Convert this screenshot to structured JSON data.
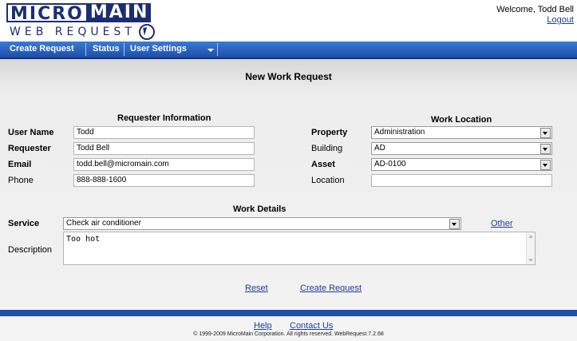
{
  "header": {
    "logo_top_a": "MICRO",
    "logo_top_b": "MAIN",
    "logo_sub": "WEB REQUEST",
    "welcome": "Welcome, Todd Bell",
    "logout": "Logout"
  },
  "nav": {
    "items": [
      {
        "label": "Create Request"
      },
      {
        "label": "Status"
      },
      {
        "label": "User Settings"
      }
    ]
  },
  "page": {
    "title": "New Work Request"
  },
  "requester": {
    "heading": "Requester Information",
    "username_label": "User Name",
    "username_value": "Todd",
    "requester_label": "Requester",
    "requester_value": "Todd Bell",
    "email_label": "Email",
    "email_value": "todd.bell@micromain.com",
    "phone_label": "Phone",
    "phone_value": "888-888-1600"
  },
  "location": {
    "heading": "Work Location",
    "property_label": "Property",
    "property_value": "Administration",
    "building_label": "Building",
    "building_value": "AD",
    "asset_label": "Asset",
    "asset_value": "AD-0100",
    "location_label": "Location",
    "location_value": ""
  },
  "details": {
    "heading": "Work Details",
    "service_label": "Service",
    "service_value": "Check air conditioner",
    "other_link": "Other",
    "description_label": "Description",
    "description_value": "Too hot"
  },
  "actions": {
    "reset": "Reset",
    "create": "Create Request"
  },
  "footer": {
    "help": "Help",
    "contact": "Contact Us",
    "copyright": "© 1999-2009 MicroMain Corporation. All rights reserved. WebRequest 7.2.68"
  },
  "colors": {
    "brand": "#1d2d73",
    "nav": "#1d4faa",
    "link": "#1f3d9a"
  }
}
